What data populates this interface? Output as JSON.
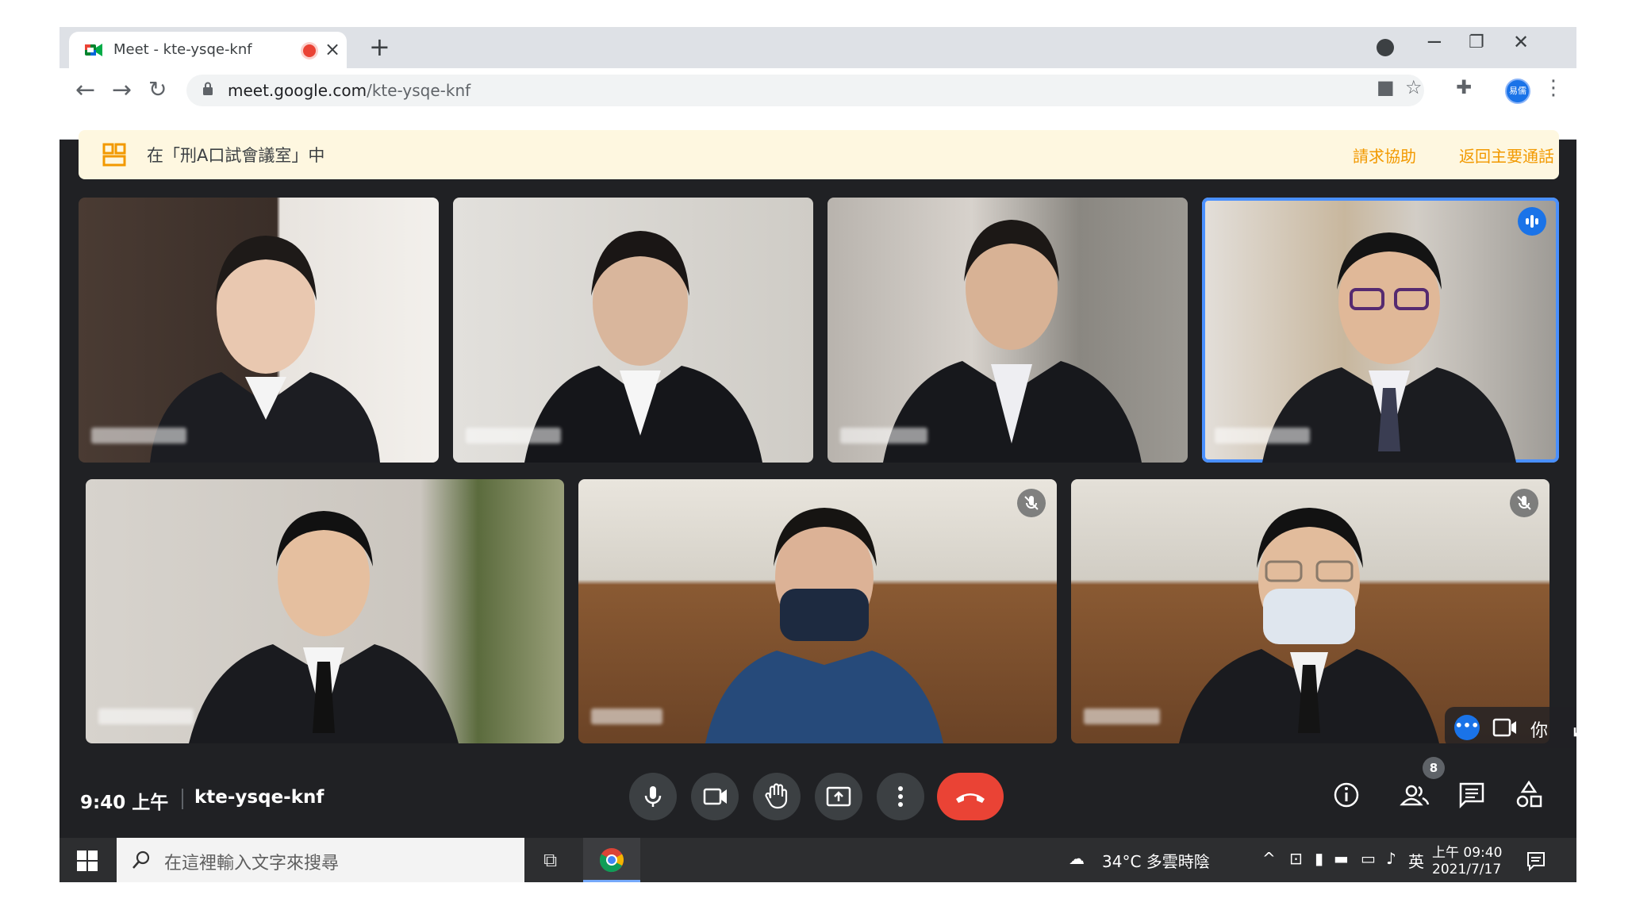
{
  "browser": {
    "tab_title": "Meet - kte-ysqe-knf",
    "tab_close": "×",
    "new_tab": "+",
    "url_domain": "meet.google.com",
    "url_path": "/kte-ysqe-knf",
    "profile_avatar_text": "易儒",
    "window_controls": [
      "−",
      "❐",
      "✕"
    ]
  },
  "banner": {
    "room_text": "在「刑A口試會議室」中",
    "help_link": "請求協助",
    "return_link": "返回主要通話"
  },
  "participants": [
    {
      "speaking": false,
      "muted": false,
      "attire": "black suit"
    },
    {
      "speaking": false,
      "muted": false,
      "attire": "black suit"
    },
    {
      "speaking": false,
      "muted": false,
      "attire": "black suit"
    },
    {
      "speaking": true,
      "muted": false,
      "attire": "suit, striped tie"
    },
    {
      "speaking": false,
      "muted": false,
      "attire": "suit, black tie"
    },
    {
      "speaking": false,
      "muted": true,
      "attire": "navy shirt, mask"
    },
    {
      "speaking": false,
      "muted": true,
      "attire": "suit, mask"
    }
  ],
  "self_tile_controls": {
    "you_label": "你"
  },
  "meeting": {
    "time": "9:40 上午",
    "code": "kte-ysqe-knf",
    "participant_count": "8"
  },
  "taskbar": {
    "search_placeholder": "在這裡輸入文字來搜尋",
    "weather": "34°C 多雲時陰",
    "ime": "英",
    "clock_time": "上午 09:40",
    "clock_date": "2021/7/17"
  },
  "colors": {
    "meet_bg": "#202124",
    "hangup": "#ea4335",
    "accent_blue": "#1a73e8",
    "banner_bg": "#fef7e0",
    "banner_link": "#f29900"
  }
}
